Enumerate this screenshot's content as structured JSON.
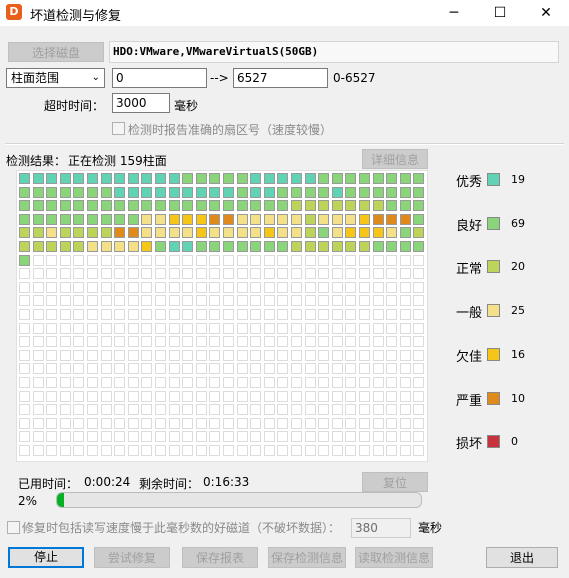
{
  "window": {
    "title": "坏道检测与修复",
    "minimize": "─",
    "maximize": "☐",
    "close": "✕",
    "app_icon_text": "D"
  },
  "toolbar": {
    "select_disk_label": "选择磁盘",
    "disk_info": "HDO:VMware,VMwareVirtualS(50GB)",
    "range_mode": "柱面范围",
    "range_start": "0",
    "range_arrow": "-->",
    "range_end": "6527",
    "range_hint": "0-6527",
    "timeout_label": "超时时间：",
    "timeout_value": "3000",
    "timeout_unit": "毫秒",
    "report_sector_label": "检测时报告准确的扇区号（速度较慢）"
  },
  "status": {
    "result_label": "检测结果：",
    "result_text": "正在检测 159柱面",
    "details_button": "详细信息",
    "elapsed_label": "已用时间：",
    "elapsed_value": "0:00:24",
    "remaining_label": "剩余时间：",
    "remaining_value": "0:16:33",
    "reset_button": "复位",
    "progress_text": "2%",
    "progress_fraction": 0.02
  },
  "legend": [
    {
      "label": "优秀",
      "count": "19",
      "color": "#5fd3b4"
    },
    {
      "label": "良好",
      "count": "69",
      "color": "#8ad47a"
    },
    {
      "label": "正常",
      "count": "20",
      "color": "#bcd45a"
    },
    {
      "label": "一般",
      "count": "25",
      "color": "#f5e08a"
    },
    {
      "label": "欠佳",
      "count": "16",
      "color": "#f5c518"
    },
    {
      "label": "严重",
      "count": "10",
      "color": "#e08a1c"
    },
    {
      "label": "损坏",
      "count": "0",
      "color": "#c8323c"
    }
  ],
  "grid_columns": 30,
  "grid_rows": 21,
  "grid_cells": "1111111111112222211111222222222222222111111111211222212222222222222222222222222233333332222222222224455566444443444566623343333664444544445443245554233333344445211222222233333322222",
  "options": {
    "include_slow_label": "修复时包括读写速度慢于此毫秒数的好磁道（不破坏数据）：",
    "slow_threshold": "380",
    "slow_unit": "毫秒"
  },
  "buttons": {
    "stop": "停止",
    "try_repair": "尝试修复",
    "save_report": "保存报表",
    "save_info": "保存检测信息",
    "read_info": "读取检测信息",
    "exit": "退出"
  }
}
